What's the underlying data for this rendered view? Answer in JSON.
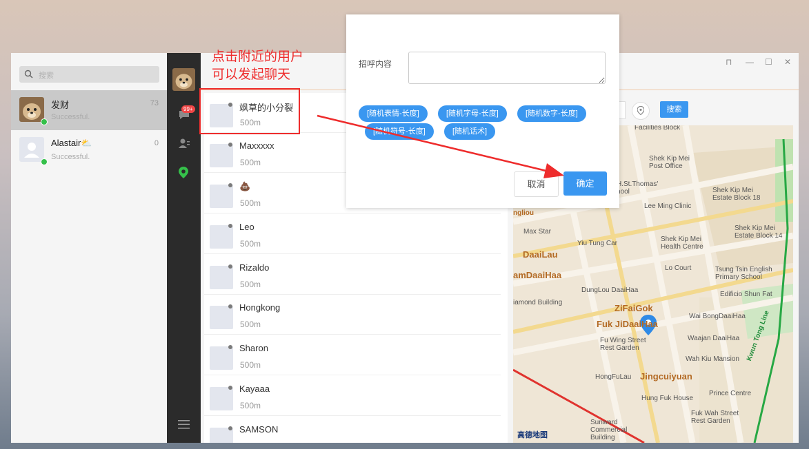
{
  "left_panel": {
    "search_placeholder": "搜索",
    "conversations": [
      {
        "name": "发财",
        "subtitle": "Successful.",
        "count": "73",
        "active": true
      },
      {
        "name": "Alastair⛅",
        "subtitle": "Successful.",
        "count": "0",
        "active": false
      }
    ]
  },
  "icon_bar": {
    "badge": "99+"
  },
  "nearby": {
    "users": [
      {
        "name": "飒草的小分裂",
        "distance": "500m"
      },
      {
        "name": "Maxxxxx",
        "distance": "500m"
      },
      {
        "name": "💩",
        "distance": "500m"
      },
      {
        "name": "Leo",
        "distance": "500m"
      },
      {
        "name": "Rizaldo",
        "distance": "500m"
      },
      {
        "name": "Hongkong",
        "distance": "500m"
      },
      {
        "name": "Sharon",
        "distance": "500m"
      },
      {
        "name": "Kayaaa",
        "distance": "500m"
      },
      {
        "name": "SAMSON",
        "distance": ""
      }
    ]
  },
  "map": {
    "search_label": "搜索",
    "logo": "高德地图",
    "labels": [
      "Facilities Block",
      "Shek Kip Mei Post Office",
      "H.St.Thomas' hool",
      "Shek Kip Mei Estate Block 18",
      "Lee Ming Clinic",
      "Max Star",
      "Yiu Tung Car",
      "Shek Kip Mei Health Centre",
      "Shek Kip Mei Estate Block 14",
      "DaaiLau",
      "amDaaiHaa",
      "Lo Court",
      "Tsung Tsin English Primary School",
      "DungLou DaaiHaa",
      "Edificio Shun Fat",
      "iamond Building",
      "ZiFaiGok",
      "Fuk JiDaaiHaa",
      "Wai BongDaaiHaa",
      "Fu Wing Street Rest Garden",
      "Waajan DaaiHaa",
      "Wah Kiu Mansion",
      "HongFuLau",
      "Jingcuiyuan",
      "Hung Fuk House",
      "Prince Centre",
      "Sunward Commercial Building",
      "Fuk Wah Street Rest Garden",
      "Kwun Tong Line",
      "ngliou"
    ]
  },
  "dialog": {
    "label": "招呼内容",
    "textarea_value": "",
    "chips": [
      "[随机表情-长度]",
      "[随机字母-长度]",
      "[随机数字-长度]",
      "[随机符号-长度]",
      "[随机话术]"
    ],
    "cancel": "取消",
    "ok": "确定"
  },
  "annotation": {
    "line1": "点击附近的用户",
    "line2": "可以发起聊天"
  },
  "colors": {
    "accent": "#3a97f0",
    "annotation": "#ee2c2c",
    "online": "#35c04a",
    "sidebar": "#2b2b2b"
  }
}
